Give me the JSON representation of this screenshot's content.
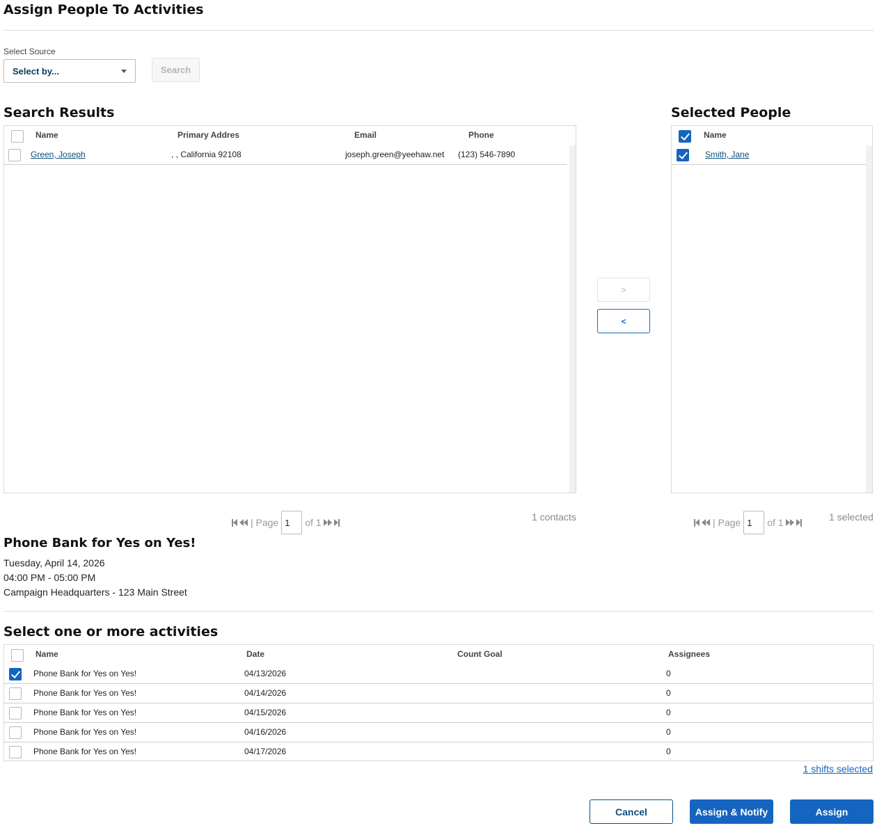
{
  "page": {
    "title": "Assign People To Activities"
  },
  "source": {
    "label": "Select Source",
    "select_value": "Select by...",
    "search_label": "Search"
  },
  "search_results": {
    "title": "Search Results",
    "columns": [
      "Name",
      "Primary Addres",
      "Email",
      "Phone"
    ],
    "rows": [
      {
        "name": "Green, Joseph",
        "address": ", , California 92108",
        "email": "joseph.green@yeehaw.net",
        "phone": "(123) 546-7890",
        "checked": false
      }
    ],
    "pager": {
      "page_label": "| Page",
      "page_value": "1",
      "of_label": "of 1"
    },
    "count_text": "1 contacts"
  },
  "move": {
    "add_label": ">",
    "remove_label": "<"
  },
  "selected_people": {
    "title": "Selected People",
    "columns": [
      "Name"
    ],
    "rows": [
      {
        "name": "Smith, Jane",
        "checked": true
      }
    ],
    "pager": {
      "page_label": "| Page",
      "page_value": "1",
      "of_label": "of 1"
    },
    "count_text": "1 selected"
  },
  "event": {
    "title": "Phone Bank for Yes on Yes!",
    "date": "Tuesday, April 14, 2026",
    "time": "04:00 PM - 05:00 PM",
    "location": "Campaign Headquarters - 123 Main Street"
  },
  "activities": {
    "title": "Select one or more activities",
    "columns": [
      "Name",
      "Date",
      "Count Goal",
      "Assignees"
    ],
    "rows": [
      {
        "name": "Phone Bank for Yes on Yes!",
        "date": "04/13/2026",
        "goal": "",
        "assignees": "0",
        "checked": true
      },
      {
        "name": "Phone Bank for Yes on Yes!",
        "date": "04/14/2026",
        "goal": "",
        "assignees": "0",
        "checked": false
      },
      {
        "name": "Phone Bank for Yes on Yes!",
        "date": "04/15/2026",
        "goal": "",
        "assignees": "0",
        "checked": false
      },
      {
        "name": "Phone Bank for Yes on Yes!",
        "date": "04/16/2026",
        "goal": "",
        "assignees": "0",
        "checked": false
      },
      {
        "name": "Phone Bank for Yes on Yes!",
        "date": "04/17/2026",
        "goal": "",
        "assignees": "0",
        "checked": false
      }
    ],
    "shifts_link": "1 shifts selected"
  },
  "footer": {
    "cancel_label": "Cancel",
    "assign_notify_label": "Assign & Notify",
    "assign_label": "Assign"
  },
  "colors": {
    "primary": "#1565c0",
    "link": "#0b4f7c",
    "border": "#d8d8d8"
  }
}
